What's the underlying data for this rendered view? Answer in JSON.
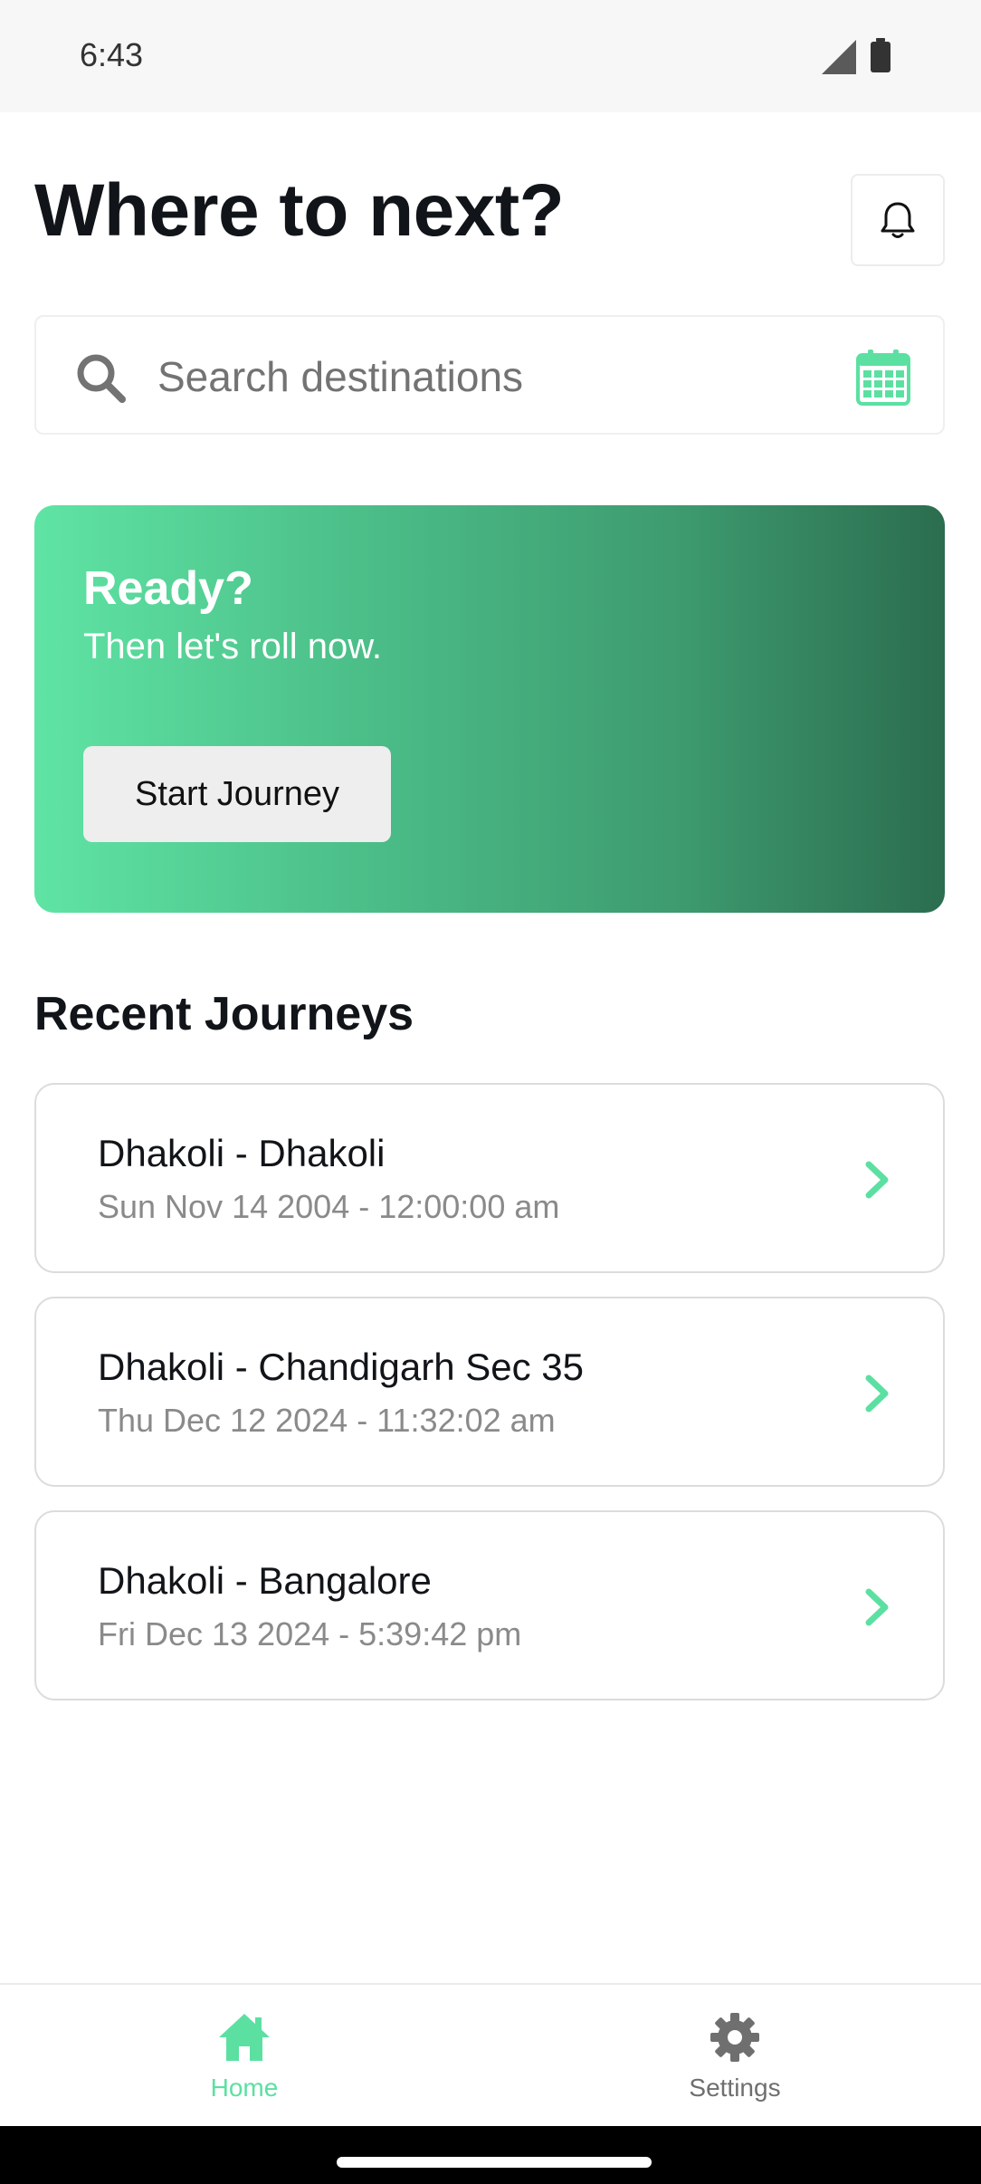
{
  "status_bar": {
    "time": "6:43",
    "icons": [
      "signal-icon",
      "battery-icon"
    ]
  },
  "header": {
    "title": "Where to next?",
    "bell_icon": "bell-icon"
  },
  "search": {
    "placeholder": "Search destinations",
    "value": "",
    "search_icon": "search-icon",
    "calendar_icon": "calendar-icon"
  },
  "hero": {
    "title": "Ready?",
    "subtitle": "Then let's roll now.",
    "button_label": "Start Journey"
  },
  "recent": {
    "title": "Recent Journeys",
    "items": [
      {
        "route": "Dhakoli - Dhakoli",
        "datetime": "Sun Nov 14 2004 - 12:00:00 am"
      },
      {
        "route": "Dhakoli - Chandigarh Sec 35",
        "datetime": "Thu Dec 12 2024 - 11:32:02 am"
      },
      {
        "route": "Dhakoli - Bangalore",
        "datetime": "Fri Dec 13 2024 - 5:39:42 pm"
      }
    ]
  },
  "bottom_nav": {
    "items": [
      {
        "label": "Home",
        "icon": "home-icon",
        "active": true
      },
      {
        "label": "Settings",
        "icon": "gear-icon",
        "active": false
      }
    ]
  },
  "colors": {
    "accent": "#5ce0a2",
    "hero_gradient_start": "#5fe4a4",
    "hero_gradient_end": "#2b6d4f",
    "muted_text": "#8a8a8a"
  }
}
